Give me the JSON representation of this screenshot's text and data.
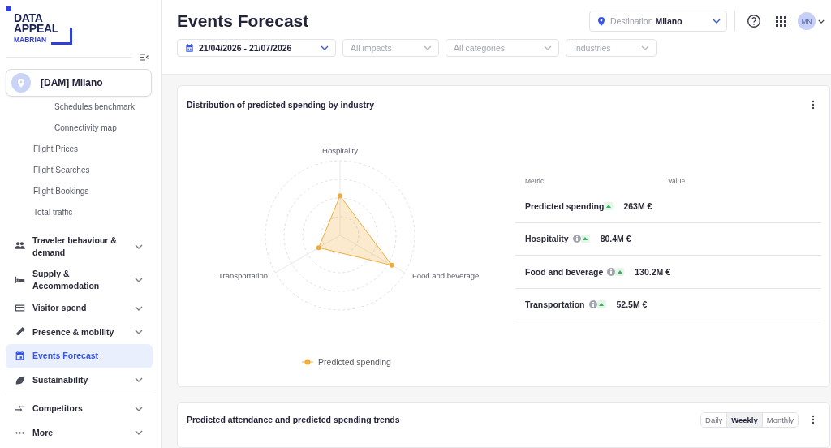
{
  "logo": {
    "wordmark": "DATA APPEAL",
    "subtitle": "MABRIAN"
  },
  "destination_card": {
    "label": "[DAM] Milano"
  },
  "submenu": [
    {
      "children": [
        {
          "label": "Schedules benchmark"
        },
        {
          "label": "Connectivity map"
        }
      ]
    },
    {
      "label": "Flight Prices"
    },
    {
      "label": "Flight Searches"
    },
    {
      "label": "Flight Bookings"
    },
    {
      "label": "Total traffic"
    }
  ],
  "nav": [
    {
      "label": "Traveler behaviour & demand",
      "expandable": true,
      "selected": false
    },
    {
      "label": "Supply & Accommodation",
      "expandable": true,
      "selected": false
    },
    {
      "label": "Visitor spend",
      "expandable": true,
      "selected": false
    },
    {
      "label": "Presence & mobility",
      "expandable": true,
      "selected": false
    },
    {
      "label": "Events Forecast",
      "expandable": false,
      "selected": true
    },
    {
      "label": "Sustainability",
      "expandable": true,
      "selected": false
    }
  ],
  "nav_secondary": [
    {
      "label": "Competitors",
      "expandable": true,
      "selected": false
    },
    {
      "label": "More",
      "expandable": true,
      "selected": false
    }
  ],
  "header": {
    "title": "Events Forecast",
    "destination": {
      "prefix": "Destination",
      "value": "Milano"
    },
    "avatar": "MN"
  },
  "filters": [
    {
      "kind": "date",
      "value": "21/04/2026 - 21/07/2026"
    },
    {
      "kind": "select",
      "placeholder": "All impacts"
    },
    {
      "kind": "select",
      "placeholder": "All categories"
    },
    {
      "kind": "select",
      "placeholder": "Industries"
    }
  ],
  "spending_card": {
    "title": "Distribution of predicted spending by industry",
    "radar": {
      "axes": [
        "Hospitality",
        "Transportation",
        "Food and beverage"
      ],
      "legend": "Predicted spending"
    },
    "table": {
      "columns": [
        "Metric",
        "Value"
      ],
      "rows": [
        {
          "kind": "total",
          "metric": "Predicted spending",
          "value": "263M €"
        },
        {
          "kind": "item",
          "metric": "Hospitality",
          "value": "80.4M €"
        },
        {
          "kind": "item",
          "metric": "Food and beverage",
          "value": "130.2M €"
        },
        {
          "kind": "item",
          "metric": "Transportation",
          "value": "52.5M €"
        }
      ]
    }
  },
  "trends_card": {
    "title": "Predicted attendance and predicted spending trends",
    "periods": [
      {
        "label": "Daily",
        "selected": false
      },
      {
        "label": "Weekly",
        "selected": true
      },
      {
        "label": "Monthly",
        "selected": false
      }
    ]
  }
}
